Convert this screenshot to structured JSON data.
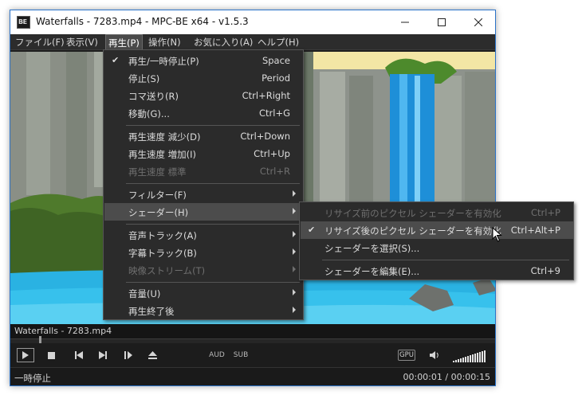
{
  "window": {
    "icon_text": "BE",
    "title": "Waterfalls - 7283.mp4 - MPC-BE x64 - v1.5.3"
  },
  "menubar": [
    {
      "label": "ファイル(F)"
    },
    {
      "label": "表示(V)"
    },
    {
      "label": "再生(P)"
    },
    {
      "label": "操作(N)"
    },
    {
      "label": "お気に入り(A)"
    },
    {
      "label": "ヘルプ(H)"
    }
  ],
  "play_menu": {
    "items": [
      {
        "label": "再生/一時停止(P)",
        "shortcut": "Space",
        "check": "✔"
      },
      {
        "label": "停止(S)",
        "shortcut": "Period"
      },
      {
        "label": "コマ送り(R)",
        "shortcut": "Ctrl+Right"
      },
      {
        "label": "移動(G)...",
        "shortcut": "Ctrl+G"
      },
      {
        "label": "再生速度 減少(D)",
        "shortcut": "Ctrl+Down"
      },
      {
        "label": "再生速度 増加(I)",
        "shortcut": "Ctrl+Up"
      },
      {
        "label": "再生速度 標準",
        "shortcut": "Ctrl+R"
      },
      {
        "label": "フィルター(F)"
      },
      {
        "label": "シェーダー(H)"
      },
      {
        "label": "音声トラック(A)"
      },
      {
        "label": "字幕トラック(B)"
      },
      {
        "label": "映像ストリーム(T)"
      },
      {
        "label": "音量(U)"
      },
      {
        "label": "再生終了後"
      }
    ]
  },
  "shader_menu": {
    "items": [
      {
        "label": "リサイズ前のピクセル シェーダーを有効化",
        "shortcut": "Ctrl+P"
      },
      {
        "label": "リサイズ後のピクセル シェーダーを有効化",
        "shortcut": "Ctrl+Alt+P",
        "check": "✔"
      },
      {
        "label": "シェーダーを選択(S)..."
      },
      {
        "label": "シェーダーを編集(E)...",
        "shortcut": "Ctrl+9"
      }
    ]
  },
  "player": {
    "filename": "Waterfalls - 7283.mp4",
    "aud_label": "AUD",
    "sub_label": "SUB",
    "gpu_label": "GPU",
    "status": "一時停止",
    "time": "00:00:01 / 00:00:15"
  },
  "colors": {
    "accent_border": "#2b73c9",
    "menu_bg": "#2b2b2b",
    "highlight": "#4c4c4c"
  }
}
